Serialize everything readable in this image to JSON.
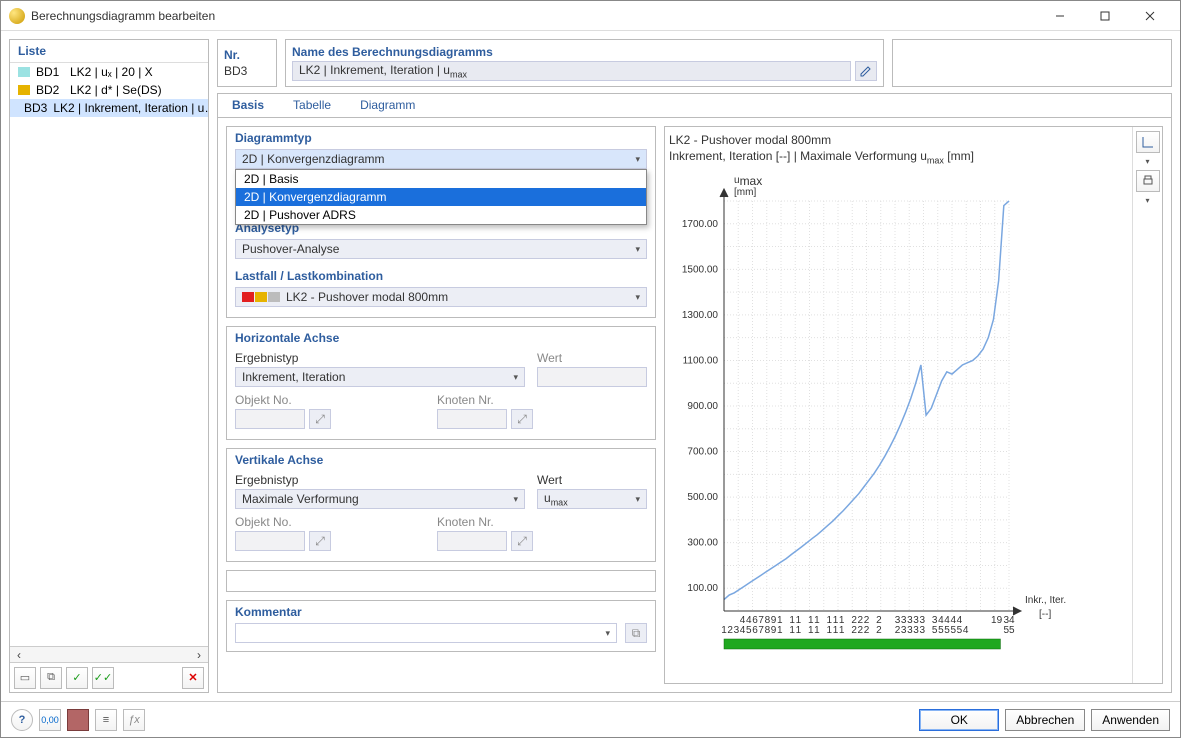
{
  "window": {
    "title": "Berechnungsdiagramm bearbeiten"
  },
  "list": {
    "header": "Liste",
    "items": [
      {
        "id": "BD1",
        "label": "LK2 | uₓ | 20 | X",
        "color": "#9be2e2"
      },
      {
        "id": "BD2",
        "label": "LK2 | d* | Se(DS)",
        "color": "#e6b300"
      },
      {
        "id": "BD3",
        "label": "LK2 | Inkrement, Iteration | u…",
        "color": "#7a6fa5",
        "selected": true
      }
    ]
  },
  "nr": {
    "label": "Nr.",
    "value": "BD3"
  },
  "name": {
    "label": "Name des Berechnungsdiagramms",
    "value": "LK2 | Inkrement, Iteration | u",
    "value_sub": "max"
  },
  "tabs": [
    "Basis",
    "Tabelle",
    "Diagramm"
  ],
  "active_tab": "Basis",
  "diagramtype": {
    "label": "Diagrammtyp",
    "value": "2D | Konvergenzdiagramm",
    "options": [
      "2D | Basis",
      "2D | Konvergenzdiagramm",
      "2D | Pushover ADRS"
    ],
    "highlighted": "2D | Konvergenzdiagramm"
  },
  "analysetype": {
    "label": "Analysetyp",
    "value": "Pushover-Analyse"
  },
  "loadcase": {
    "label": "Lastfall / Lastkombination",
    "value": "LK2 - Pushover modal 800mm",
    "colors": [
      "#e21f1f",
      "#e6b300",
      "#bcbcbc"
    ]
  },
  "haxis": {
    "title": "Horizontale Achse",
    "ergebnistyp_label": "Ergebnistyp",
    "ergebnistyp": "Inkrement, Iteration",
    "wert_label": "Wert",
    "objekt_label": "Objekt No.",
    "knoten_label": "Knoten Nr."
  },
  "vaxis": {
    "title": "Vertikale Achse",
    "ergebnistyp_label": "Ergebnistyp",
    "ergebnistyp": "Maximale Verformung",
    "wert_label": "Wert",
    "wert": "u",
    "wert_sub": "max",
    "objekt_label": "Objekt No.",
    "knoten_label": "Knoten Nr."
  },
  "comment": {
    "label": "Kommentar"
  },
  "chart_title": {
    "line1": "LK2 - Pushover modal 800mm",
    "line2": "Inkrement, Iteration [--] | Maximale Verformung u",
    "line2_sub": "max",
    "line2_tail": " [mm]"
  },
  "chart_axis": {
    "y_label1": "u",
    "y_label_sub": "max",
    "y_label2": "[mm]",
    "x_label1": "Inkr., Iter.",
    "x_label2": "[--]"
  },
  "buttons": {
    "ok": "OK",
    "cancel": "Abbrechen",
    "apply": "Anwenden"
  },
  "chart_data": {
    "type": "line",
    "title": "LK2 - Pushover modal 800mm",
    "xlabel": "Inkr., Iter. [--]",
    "ylabel": "umax [mm]",
    "ylim": [
      0,
      1800
    ],
    "y_ticks": [
      100,
      300,
      500,
      700,
      900,
      1100,
      1300,
      1500,
      1700
    ],
    "x_tick_labels_top": [
      "",
      "",
      "",
      "4",
      "4",
      "6",
      "7",
      "8",
      "9",
      "1",
      "",
      "1",
      "1",
      "",
      "1",
      "1",
      "",
      "1",
      "1",
      "1",
      "",
      "2",
      "2",
      "2",
      "",
      "2",
      "",
      "",
      "3",
      "3",
      "3",
      "3",
      "3",
      "",
      "3",
      "4",
      "4",
      "4",
      "4",
      "",
      "",
      "",
      "",
      "",
      "19",
      "",
      "34"
    ],
    "x_tick_labels_bottom": [
      "1",
      "2",
      "3",
      "4",
      "5",
      "6",
      "7",
      "8",
      "9",
      "1",
      "",
      "1",
      "1",
      "",
      "1",
      "1",
      "",
      "1",
      "1",
      "1",
      "",
      "2",
      "2",
      "2",
      "",
      "2",
      "",
      "",
      "2",
      "3",
      "3",
      "3",
      "3",
      "",
      "5",
      "5",
      "5",
      "5",
      "5",
      "4",
      "",
      "",
      "",
      "",
      "",
      "",
      "55"
    ],
    "x": [
      1,
      2,
      3,
      4,
      5,
      6,
      7,
      8,
      9,
      10,
      11,
      12,
      13,
      14,
      15,
      16,
      17,
      18,
      19,
      20,
      21,
      22,
      23,
      24,
      25,
      26,
      27,
      28,
      29,
      30,
      31,
      32,
      33,
      34,
      35,
      36,
      37,
      38,
      39,
      40,
      41,
      42,
      43,
      44,
      45,
      46,
      47,
      48,
      49,
      50,
      51,
      52,
      53,
      54,
      55,
      56
    ],
    "values": [
      50,
      70,
      80,
      95,
      110,
      125,
      140,
      155,
      170,
      185,
      200,
      215,
      230,
      248,
      265,
      282,
      300,
      318,
      335,
      355,
      375,
      395,
      418,
      440,
      465,
      490,
      515,
      545,
      575,
      605,
      640,
      678,
      720,
      765,
      815,
      870,
      930,
      1000,
      1080,
      860,
      890,
      950,
      1010,
      1050,
      1040,
      1060,
      1080,
      1090,
      1100,
      1120,
      1150,
      1200,
      1280,
      1450,
      1780,
      1800
    ]
  }
}
